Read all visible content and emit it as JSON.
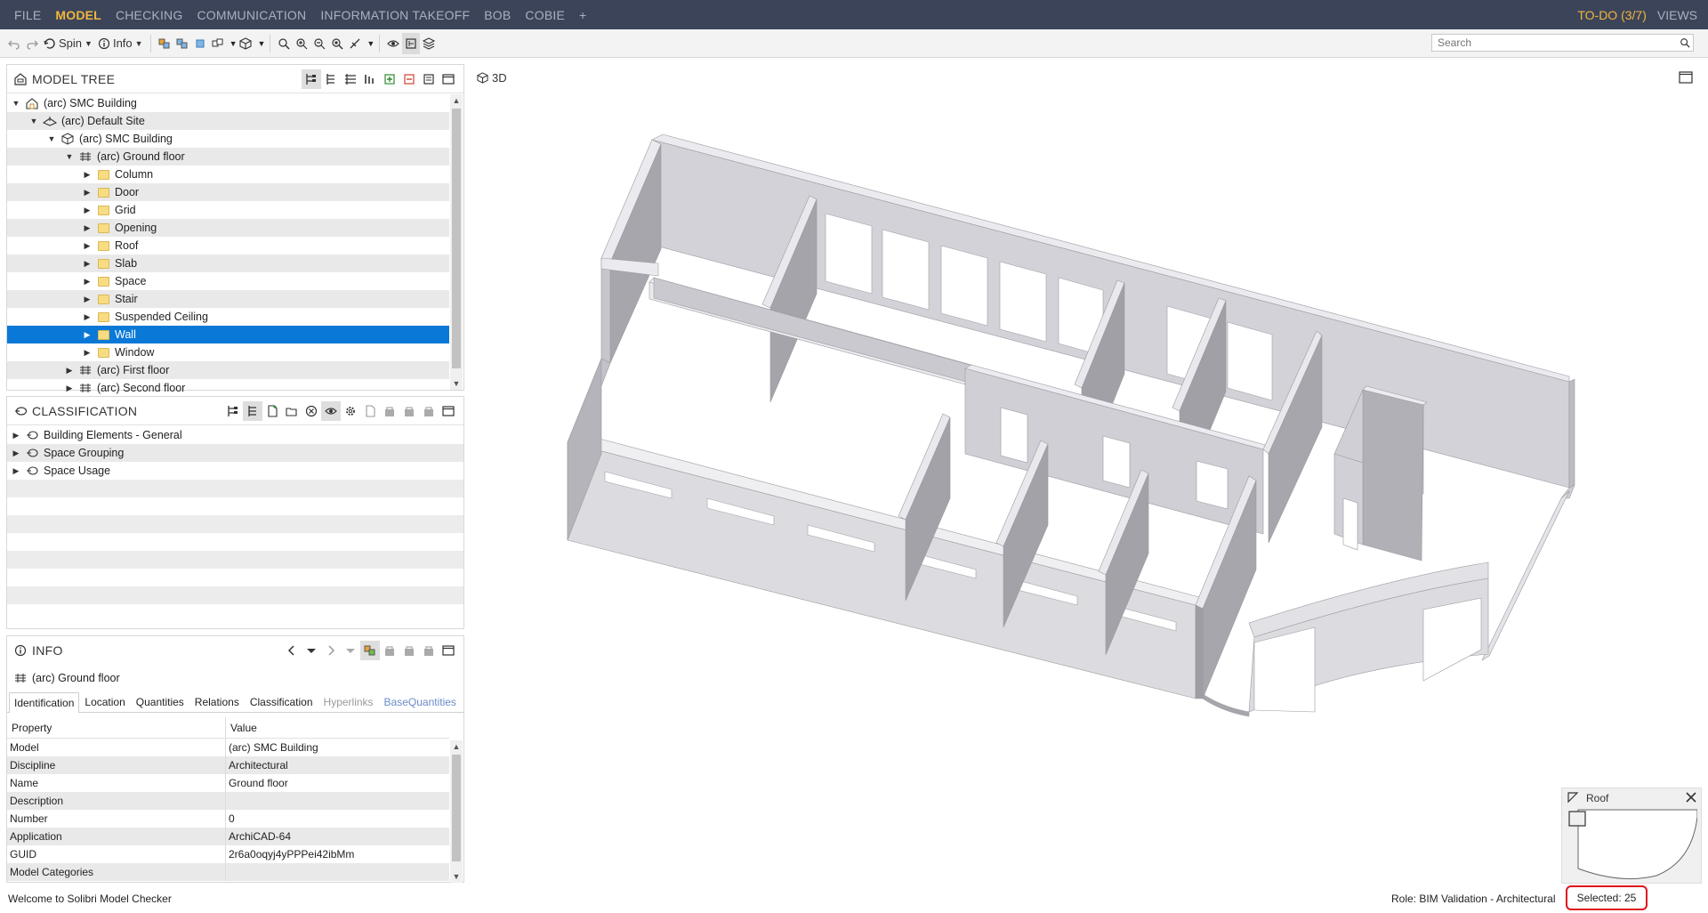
{
  "menu": {
    "items": [
      "FILE",
      "MODEL",
      "CHECKING",
      "COMMUNICATION",
      "INFORMATION TAKEOFF",
      "BOB",
      "COBIE",
      "+"
    ],
    "active": "MODEL",
    "todo": "TO-DO (3/7)",
    "views": "VIEWS"
  },
  "toolbar": {
    "spin_label": "Spin",
    "info_label": "Info",
    "search_placeholder": "Search"
  },
  "model_tree": {
    "title": "MODEL TREE",
    "rows": [
      {
        "label": "(arc) SMC Building",
        "depth": 0,
        "icon": "building-icon",
        "expanded": true
      },
      {
        "label": "(arc) Default Site",
        "depth": 1,
        "icon": "site-icon",
        "expanded": true
      },
      {
        "label": "(arc) SMC Building",
        "depth": 2,
        "icon": "building-cube-icon",
        "expanded": true
      },
      {
        "label": "(arc) Ground floor",
        "depth": 3,
        "icon": "floor-icon",
        "expanded": true
      },
      {
        "label": "Column",
        "depth": 4,
        "icon": "folder-icon",
        "expanded": false
      },
      {
        "label": "Door",
        "depth": 4,
        "icon": "folder-icon",
        "expanded": false
      },
      {
        "label": "Grid",
        "depth": 4,
        "icon": "folder-icon",
        "expanded": false
      },
      {
        "label": "Opening",
        "depth": 4,
        "icon": "folder-icon",
        "expanded": false
      },
      {
        "label": "Roof",
        "depth": 4,
        "icon": "folder-icon",
        "expanded": false
      },
      {
        "label": "Slab",
        "depth": 4,
        "icon": "folder-icon",
        "expanded": false
      },
      {
        "label": "Space",
        "depth": 4,
        "icon": "folder-icon",
        "expanded": false
      },
      {
        "label": "Stair",
        "depth": 4,
        "icon": "folder-icon",
        "expanded": false
      },
      {
        "label": "Suspended Ceiling",
        "depth": 4,
        "icon": "folder-icon",
        "expanded": false
      },
      {
        "label": "Wall",
        "depth": 4,
        "icon": "folder-icon",
        "expanded": false,
        "selected": true
      },
      {
        "label": "Window",
        "depth": 4,
        "icon": "folder-icon",
        "expanded": false
      },
      {
        "label": "(arc) First floor",
        "depth": 3,
        "icon": "floor-icon",
        "expanded": false
      },
      {
        "label": "(arc) Second floor",
        "depth": 3,
        "icon": "floor-icon",
        "expanded": false
      }
    ]
  },
  "classification": {
    "title": "CLASSIFICATION",
    "rows": [
      {
        "label": "Building Elements - General"
      },
      {
        "label": "Space Grouping"
      },
      {
        "label": "Space Usage"
      }
    ]
  },
  "info": {
    "title": "INFO",
    "subject": "(arc) Ground floor",
    "tabs": [
      {
        "label": "Identification",
        "state": "active"
      },
      {
        "label": "Location",
        "state": "normal"
      },
      {
        "label": "Quantities",
        "state": "normal"
      },
      {
        "label": "Relations",
        "state": "normal"
      },
      {
        "label": "Classification",
        "state": "normal"
      },
      {
        "label": "Hyperlinks",
        "state": "disabled"
      },
      {
        "label": "BaseQuantities",
        "state": "link"
      }
    ],
    "columns": {
      "property": "Property",
      "value": "Value"
    },
    "rows": [
      {
        "property": "Model",
        "value": "(arc) SMC Building"
      },
      {
        "property": "Discipline",
        "value": "Architectural"
      },
      {
        "property": "Name",
        "value": "Ground floor"
      },
      {
        "property": "Description",
        "value": ""
      },
      {
        "property": "Number",
        "value": "0"
      },
      {
        "property": "Application",
        "value": "ArchiCAD-64"
      },
      {
        "property": "GUID",
        "value": "2r6a0oqyj4yPPPei42ibMm"
      },
      {
        "property": "Model Categories",
        "value": ""
      }
    ]
  },
  "viewport": {
    "tab_label": "3D"
  },
  "minimap": {
    "title": "Roof"
  },
  "status": {
    "welcome": "Welcome to Solibri Model Checker",
    "role": "Role: BIM Validation - Architectural",
    "selected": "Selected: 25"
  },
  "colors": {
    "menubar_bg": "#3c4459",
    "accent": "#f0b63e",
    "selection": "#0a78d7",
    "highlight_box": "#e0141e"
  }
}
